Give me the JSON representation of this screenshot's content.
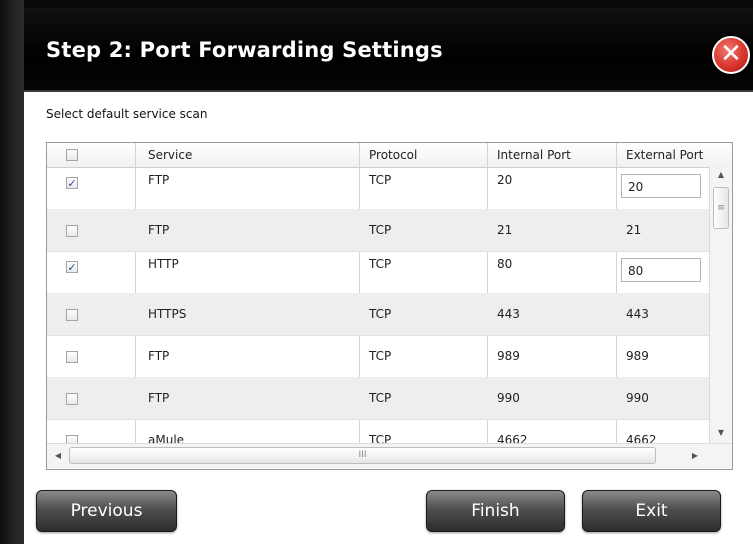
{
  "dialog": {
    "title": "Step 2: Port Forwarding Settings",
    "close_icon": "close-icon",
    "subtitle": "Select default service scan"
  },
  "table": {
    "headers": {
      "service": "Service",
      "protocol": "Protocol",
      "internal_port": "Internal Port",
      "external_port": "External Port"
    },
    "rows": [
      {
        "checked": true,
        "service": "FTP",
        "protocol": "TCP",
        "internal_port": "20",
        "external_port": "20"
      },
      {
        "checked": false,
        "service": "FTP",
        "protocol": "TCP",
        "internal_port": "21",
        "external_port": "21"
      },
      {
        "checked": true,
        "service": "HTTP",
        "protocol": "TCP",
        "internal_port": "80",
        "external_port": "80"
      },
      {
        "checked": false,
        "service": "HTTPS",
        "protocol": "TCP",
        "internal_port": "443",
        "external_port": "443"
      },
      {
        "checked": false,
        "service": "FTP",
        "protocol": "TCP",
        "internal_port": "989",
        "external_port": "989"
      },
      {
        "checked": false,
        "service": "FTP",
        "protocol": "TCP",
        "internal_port": "990",
        "external_port": "990"
      },
      {
        "checked": false,
        "service": "aMule",
        "protocol": "TCP",
        "internal_port": "4662",
        "external_port": "4662"
      }
    ],
    "check_glyph": "✓"
  },
  "buttons": {
    "previous": "Previous",
    "finish": "Finish",
    "exit": "Exit"
  },
  "colors": {
    "title_bar": "#000000",
    "close_button": "#d9362c",
    "alt_row": "#eeeeee"
  }
}
